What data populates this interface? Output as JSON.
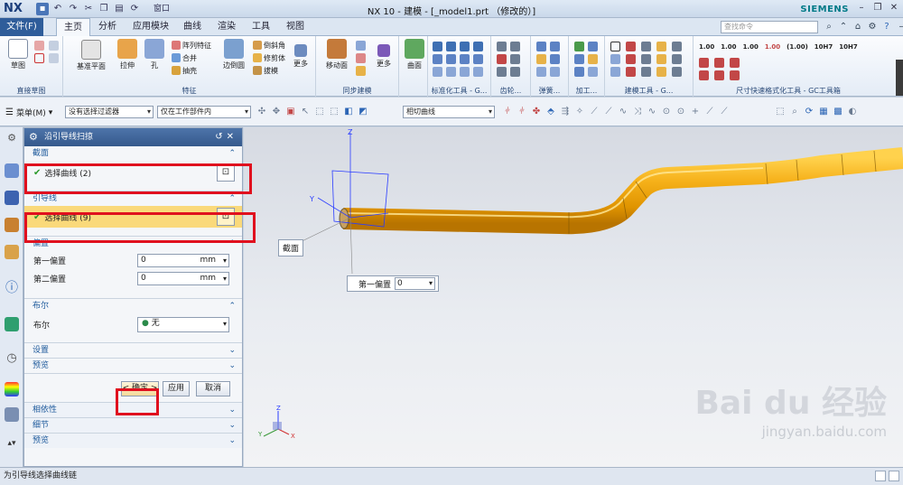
{
  "app": {
    "logo": "NX",
    "title": "NX 10 - 建模 - [_model1.prt （修改的）]",
    "brand": "SIEMENS",
    "window_menu": "窗口",
    "search_placeholder": "查找命令"
  },
  "tabs": {
    "file": "文件(F)",
    "items": [
      "主页",
      "分析",
      "应用模块",
      "曲线",
      "渲染",
      "工具",
      "视图"
    ],
    "active": "主页"
  },
  "ribbon": {
    "groups": {
      "direct_sketch": "直接草图",
      "feature": "特征",
      "sync_modeling": "同步建模",
      "standard_lib": "标准化工具 - G...",
      "gear": "齿轮...",
      "spring": "弹簧...",
      "machining": "加工...",
      "modeling_tool": "建模工具 - G...",
      "dimension": "尺寸快速格式化工具 - GC工具箱"
    },
    "buttons": {
      "sketch": "草图",
      "datum_plane": "基准平面",
      "extrude": "拉伸",
      "hole": "孔",
      "pattern_feature": "阵列特征",
      "unite": "合并",
      "shell": "抽壳",
      "edge_blend": "边倒圆",
      "chamfer": "倒斜角",
      "trim_body": "修剪体",
      "draft": "拔模",
      "more1": "更多",
      "move_face": "移动面",
      "more2": "更多",
      "surface": "曲面"
    },
    "dim_labels": [
      "1.00",
      "1.00",
      "1.00",
      "1.00",
      "(1.00)",
      "10H7",
      "10H7"
    ]
  },
  "toolbar2": {
    "menu": "菜单(M)",
    "filter": "没有选择过滤器",
    "scope": "仅在工作部件内",
    "curve_rule": "相切曲线"
  },
  "panel": {
    "title": "沿引导线扫掠",
    "section_title": "截面",
    "section_select": "选择曲线 (2)",
    "guide_title": "引导线",
    "guide_select": "选择曲线 (9)",
    "offset_title": "偏置",
    "first_offset_label": "第一偏置",
    "first_offset_value": "0",
    "first_offset_unit": "mm",
    "second_offset_label": "第二偏置",
    "second_offset_value": "0",
    "second_offset_unit": "mm",
    "bool_title": "布尔",
    "bool_label": "布尔",
    "bool_value": "无",
    "settings_title": "设置",
    "preview_title": "预览",
    "ok": "< 确定 >",
    "apply": "应用",
    "cancel": "取消",
    "dep_title": "相依性",
    "detail_title": "细节",
    "preview2_title": "预览"
  },
  "viewport": {
    "section_label": "截面",
    "offset_label": "第一偏置",
    "offset_value": "0",
    "axis_z": "Z",
    "axis_y": "Y",
    "axis_x": "X",
    "watermark_big": "Bai du 经验",
    "watermark_small": "jingyan.baidu.com"
  },
  "status": {
    "message": "为引导线选择曲线链"
  },
  "colors": {
    "pipe": "#f2a50c",
    "accent_blue": "#35598c",
    "highlight": "#fad97a",
    "red_box": "#e0101e"
  }
}
